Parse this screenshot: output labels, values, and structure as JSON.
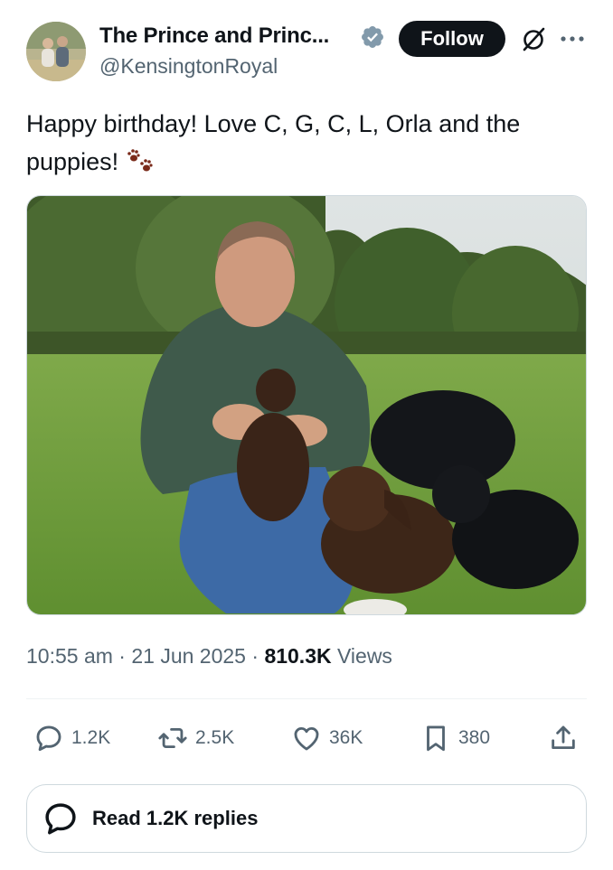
{
  "author": {
    "display_name": "The Prince and Princ...",
    "handle": "@KensingtonRoyal",
    "verified_color": "#829aab"
  },
  "header": {
    "follow_label": "Follow",
    "grok_icon": "grok-icon",
    "more_icon": "more-icon"
  },
  "tweet": {
    "text": "Happy birthday! Love C, G, C, L, Orla and the puppies!",
    "emoji": "paw-prints",
    "photo_description_icon": "photo"
  },
  "meta": {
    "time": "10:55 am",
    "separator": "·",
    "date": "21 Jun 2025",
    "views_count": "810.3K",
    "views_label": "Views"
  },
  "actions": {
    "replies": "1.2K",
    "reposts": "2.5K",
    "likes": "36K",
    "bookmarks": "380"
  },
  "replies_button": {
    "label": "Read 1.2K replies"
  },
  "colors": {
    "text": "#0f1419",
    "secondary": "#536471",
    "border": "#cfd9de"
  }
}
